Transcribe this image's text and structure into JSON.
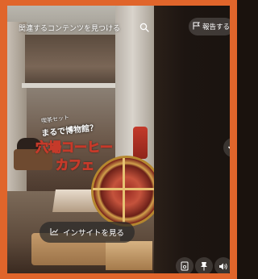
{
  "search": {
    "placeholder": "関連するコンテンツを見つける",
    "icon": "search-icon"
  },
  "report": {
    "label": "報告する",
    "icon": "flag-icon"
  },
  "overlay": {
    "small_text": "喫茶セット",
    "subtitle": "まるで博物館？",
    "title_line1": "穴場コーヒー",
    "title_line2": "カフェ"
  },
  "insight": {
    "label": "インサイトを見る",
    "icon": "chart-icon"
  },
  "controls": {
    "next_icon": "chevron-down-icon",
    "bottom_icons": [
      "document-icon",
      "pin-icon",
      "volume-icon"
    ]
  },
  "colors": {
    "border": "#e0652b",
    "accent_text_stroke": "#c53a2a"
  }
}
